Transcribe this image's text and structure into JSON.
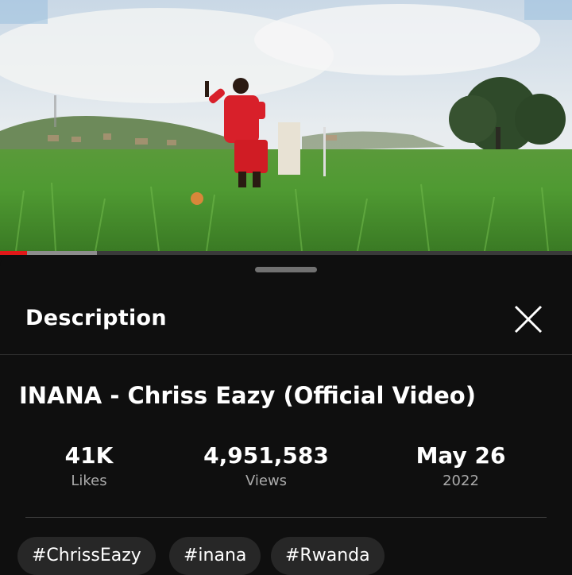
{
  "player": {
    "progress_played": 0.047,
    "progress_buffered": 0.17,
    "accent_color": "#e01818"
  },
  "sheet": {
    "title": "Description",
    "close_icon": "close-icon"
  },
  "video": {
    "title": "INANA - Chriss Eazy (Official Video)",
    "stats": {
      "likes": {
        "value": "41K",
        "label": "Likes"
      },
      "views": {
        "value": "4,951,583",
        "label": "Views"
      },
      "date": {
        "value": "May 26",
        "label": "2022"
      }
    },
    "hashtags": [
      "#ChrissEazy",
      "#inana",
      "#Rwanda"
    ]
  }
}
